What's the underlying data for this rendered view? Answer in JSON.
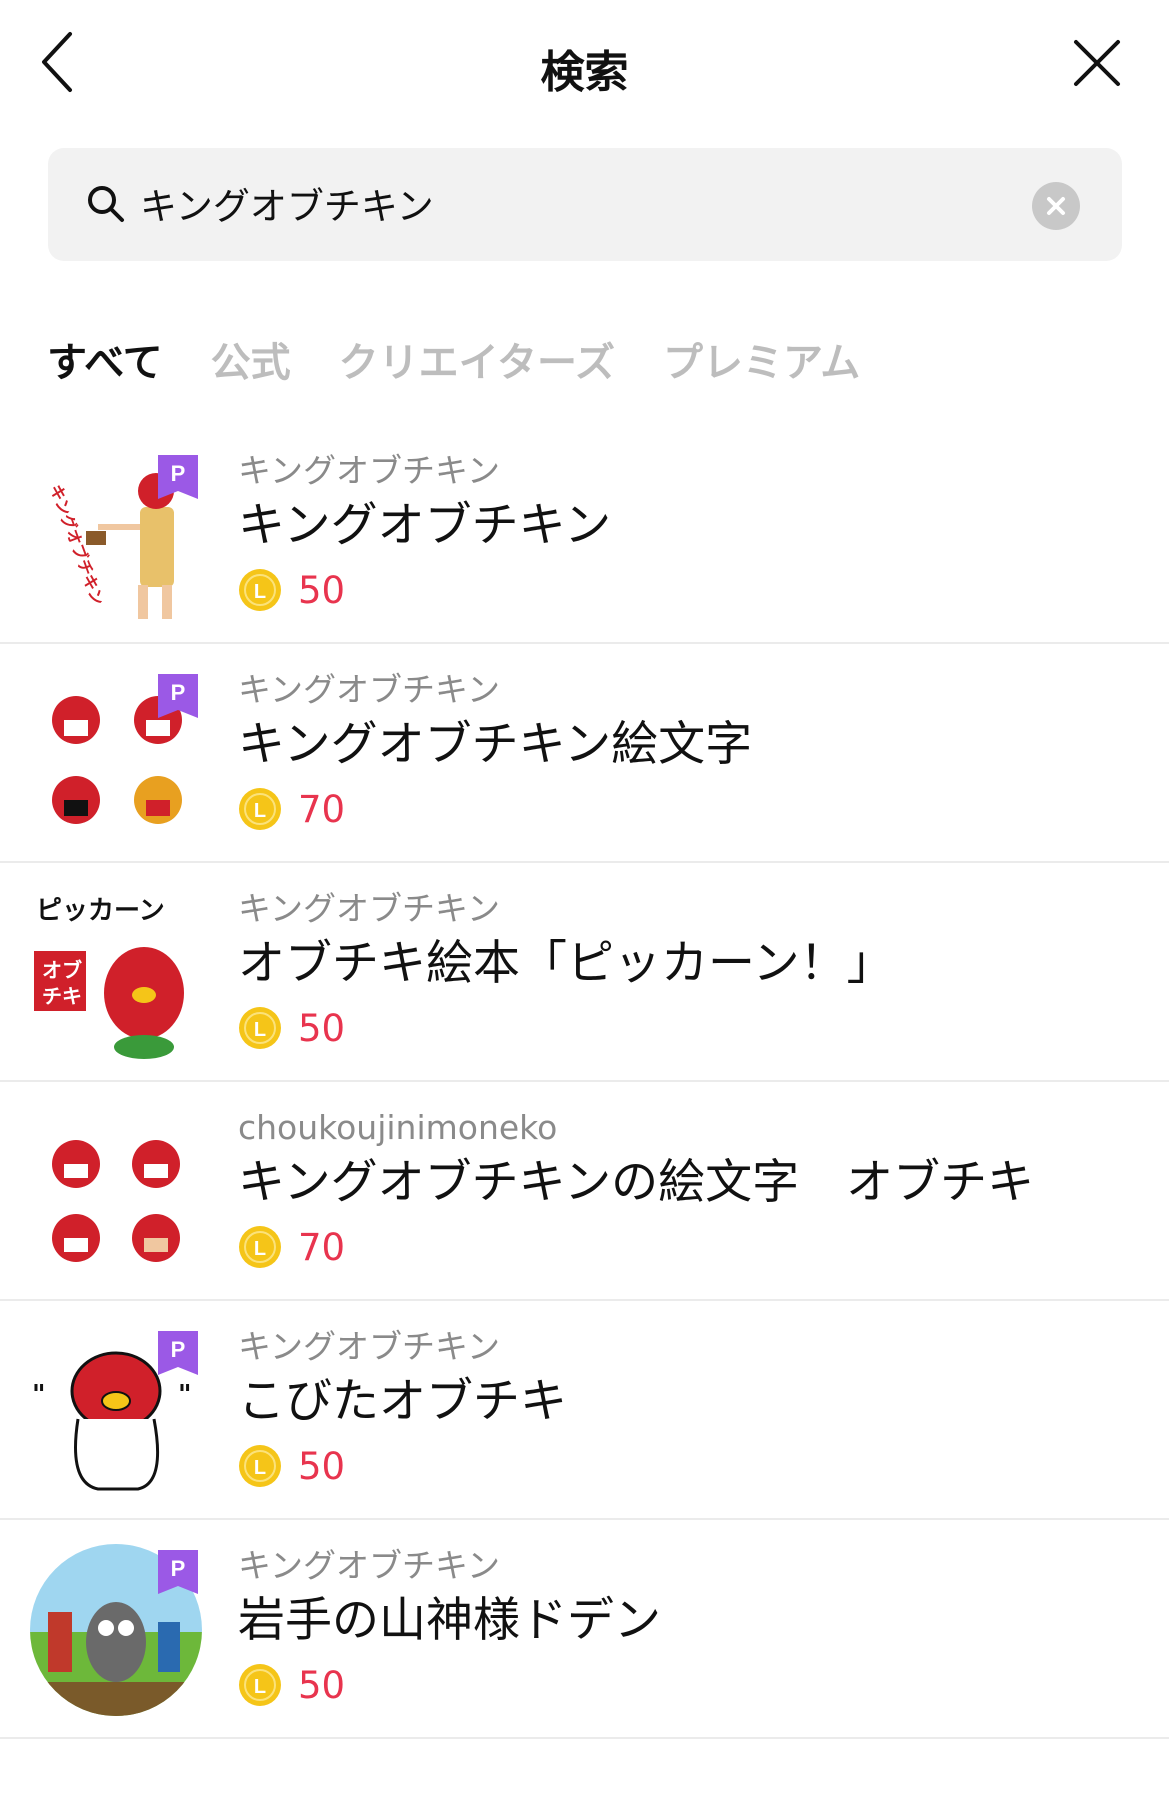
{
  "header": {
    "title": "検索"
  },
  "search": {
    "value": "キングオブチキン"
  },
  "tabs": [
    {
      "label": "すべて",
      "active": true
    },
    {
      "label": "公式",
      "active": false
    },
    {
      "label": "クリエイターズ",
      "active": false
    },
    {
      "label": "プレミアム",
      "active": false
    }
  ],
  "colors": {
    "price": "#e8344e",
    "premium_badge": "#9b59e6",
    "coin": "#f5c518",
    "tab_inactive": "#bdbdbd",
    "search_bg": "#f2f2f2"
  },
  "results": [
    {
      "author": "キングオブチキン",
      "name": "キングオブチキン",
      "price": "50",
      "premium": true,
      "thumb": "chicken-pharaoh-sticker"
    },
    {
      "author": "キングオブチキン",
      "name": "キングオブチキン絵文字",
      "price": "70",
      "premium": true,
      "thumb": "chicken-emoji-grid"
    },
    {
      "author": "キングオブチキン",
      "name": "オブチキ絵本「ピッカーン！」",
      "price": "50",
      "premium": false,
      "thumb": "pikkaan-book-cover"
    },
    {
      "author": "choukoujinimoneko",
      "name": "キングオブチキンの絵文字　オブチキ",
      "price": "70",
      "premium": false,
      "thumb": "chicken-emoji-grid-2"
    },
    {
      "author": "キングオブチキン",
      "name": "こびたオブチキ",
      "price": "50",
      "premium": true,
      "thumb": "kobita-chicken"
    },
    {
      "author": "キングオブチキン",
      "name": "岩手の山神様ドデン",
      "price": "50",
      "premium": true,
      "thumb": "iwate-mountain-god"
    }
  ]
}
